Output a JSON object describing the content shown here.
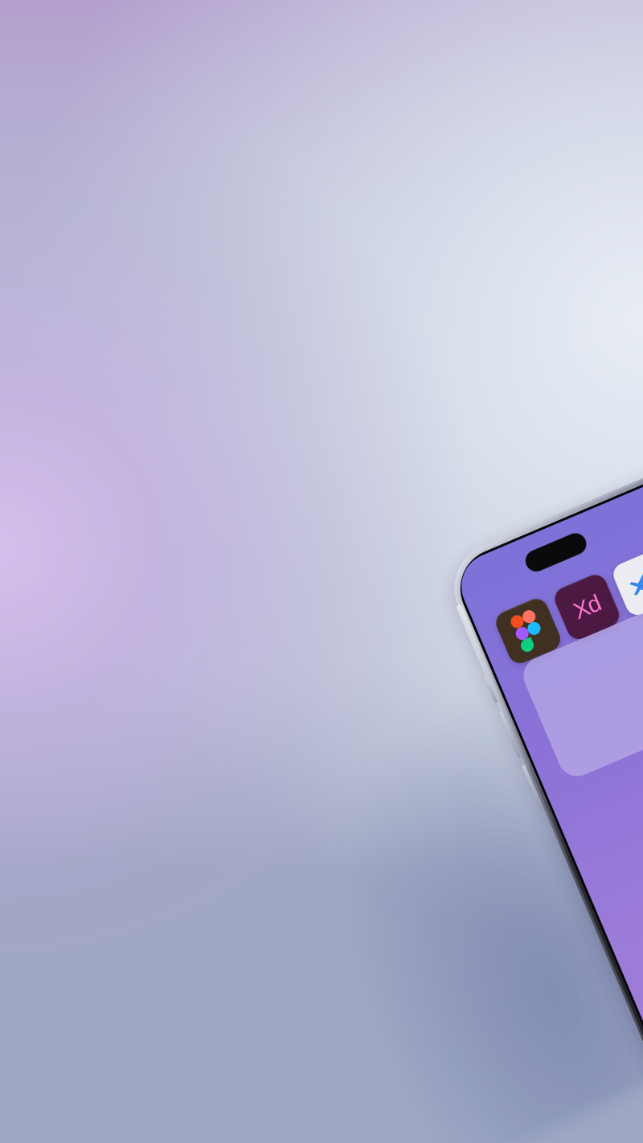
{
  "scene": {
    "background": {
      "left_glow": "#d6c2ee",
      "right_glow": "#e7edf6",
      "base_tone": "#b8bfd6"
    },
    "phone": {
      "screen_colors": [
        "#7c72d8",
        "#9a7bd8"
      ],
      "widget_color": "#c4bae9"
    },
    "apps": {
      "figma": {
        "icon": "figma-icon",
        "colors": [
          "#f24e1e",
          "#ff7262",
          "#a259ff",
          "#1abcfe",
          "#0acf83"
        ]
      },
      "xd": {
        "label": "Xd",
        "icon": "adobe-xd-icon",
        "color": "#ff75cf"
      },
      "vscode": {
        "icon": "vscode-icon",
        "color": "#2f80ed"
      }
    },
    "dock": {
      "items": [
        {
          "icon": "figma-dock-icon"
        },
        {
          "icon": "adobe-xd-dock-icon"
        }
      ]
    }
  }
}
